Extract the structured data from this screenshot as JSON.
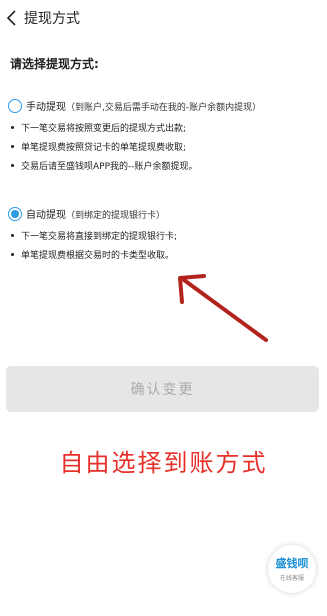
{
  "header": {
    "title": "提现方式",
    "back_icon": "chevron-left-icon"
  },
  "prompt": "请选择提现方式:",
  "options": [
    {
      "label": "手动提现",
      "description": "（到账户,交易后需手动在我的-账户余额内提现）",
      "selected": false,
      "bullets": [
        "下一笔交易将按照变更后的提现方式出款;",
        "单笔提现费按照贷记卡的单笔提现费收取;",
        "交易后请至盛钱呗APP我的--账户余额提现。"
      ]
    },
    {
      "label": "自动提现",
      "description": "（到绑定的提现银行卡）",
      "selected": true,
      "bullets": [
        "下一笔交易将直接到绑定的提现银行卡;",
        "单笔提现费根据交易时的卡类型收取。"
      ]
    }
  ],
  "confirm_button": "确认变更",
  "annotation": "自由选择到账方式",
  "service": {
    "logo_text": "盛钱呗",
    "label": "在线客服"
  },
  "colors": {
    "accent": "#2b9be6",
    "annotation_red": "#e8302a",
    "arrow_dark_red": "#b3231d",
    "button_disabled_bg": "#e6e6e6",
    "button_disabled_text": "#ababab"
  }
}
